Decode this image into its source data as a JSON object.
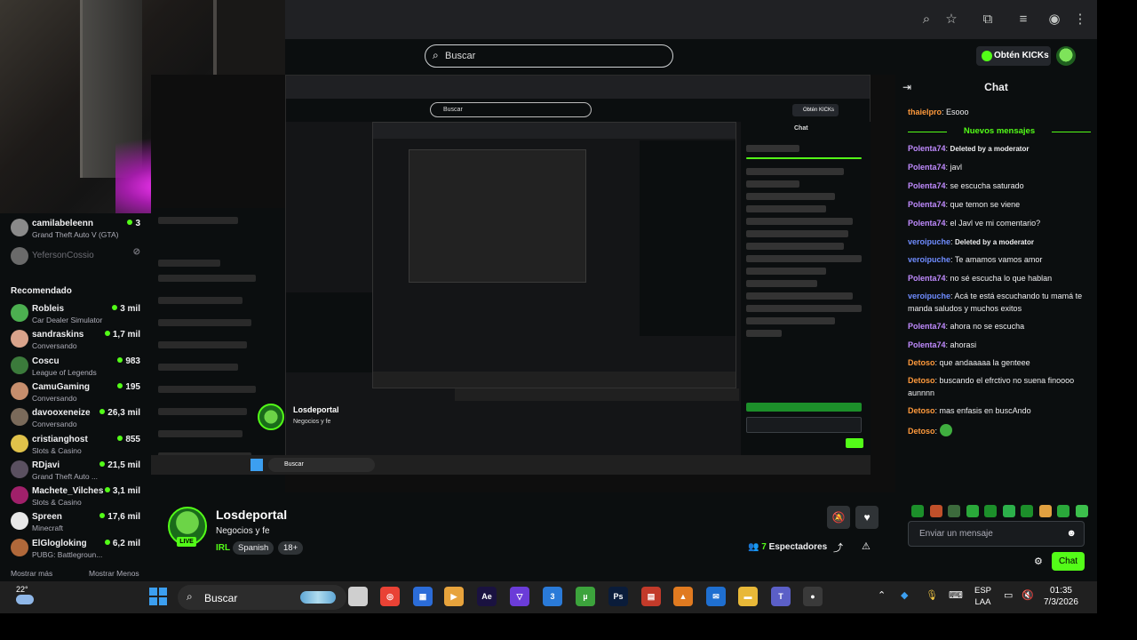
{
  "browser": {
    "icons": [
      "zoom-icon",
      "star-icon",
      "extensions-icon",
      "media-icon",
      "profile-icon",
      "menu-icon"
    ]
  },
  "header": {
    "search_placeholder": "Buscar",
    "kicks_label": "Obtén KICKs"
  },
  "sidebar": {
    "following": [
      {
        "name": "camilabeleenn",
        "category": "Grand Theft Auto V (GTA)",
        "viewers": "3"
      },
      {
        "name": "YefersonCossio",
        "category": "",
        "viewers": ""
      }
    ],
    "recommended_title": "Recomendado",
    "recommended": [
      {
        "name": "Robleis",
        "category": "Car Dealer Simulator",
        "viewers": "3 mil"
      },
      {
        "name": "sandraskins",
        "category": "Conversando",
        "viewers": "1,7 mil"
      },
      {
        "name": "Coscu",
        "category": "League of Legends",
        "viewers": "983"
      },
      {
        "name": "CamuGaming",
        "category": "Conversando",
        "viewers": "195"
      },
      {
        "name": "davooxeneize",
        "category": "Conversando",
        "viewers": "26,3 mil"
      },
      {
        "name": "cristianghost",
        "category": "Slots & Casino",
        "viewers": "855"
      },
      {
        "name": "RDjavi",
        "category": "Grand Theft Auto ...",
        "viewers": "21,5 mil"
      },
      {
        "name": "Machete_Vilches",
        "category": "Slots & Casino",
        "viewers": "3,1 mil"
      },
      {
        "name": "Spreen",
        "category": "Minecraft",
        "viewers": "17,6 mil"
      },
      {
        "name": "ElGlogloking",
        "category": "PUBG: Battlegroun...",
        "viewers": "6,2 mil"
      }
    ],
    "show_more": "Mostrar más",
    "show_less": "Mostrar Menos"
  },
  "nested": {
    "search": "Buscar",
    "chat_title": "Chat",
    "kicks": "Obtén KICKs"
  },
  "stream": {
    "channel": "Losdeportal",
    "title": "Negocios y fe",
    "category": "IRL",
    "tags": [
      "Spanish",
      "18+"
    ],
    "live": "LIVE",
    "viewers_count": "7",
    "viewers_label": "Espectadores"
  },
  "chat": {
    "title": "Chat",
    "new_messages": "Nuevos mensajes",
    "messages": [
      {
        "user": "thaielpro",
        "color": "#ff9a3c",
        "text": "Esooo"
      },
      {
        "user": "Polenta74",
        "color": "#c08bff",
        "text": "Deleted by a moderator",
        "deleted": true
      },
      {
        "user": "Polenta74",
        "color": "#c08bff",
        "text": "javl"
      },
      {
        "user": "Polenta74",
        "color": "#c08bff",
        "text": "se escucha saturado"
      },
      {
        "user": "Polenta74",
        "color": "#c08bff",
        "text": "que temon se viene"
      },
      {
        "user": "Polenta74",
        "color": "#c08bff",
        "text": "el Javl ve mi comentario?"
      },
      {
        "user": "veroipuche",
        "color": "#6f8cff",
        "text": "Deleted by a moderator",
        "deleted": true
      },
      {
        "user": "veroipuche",
        "color": "#6f8cff",
        "text": "Te amamos vamos amor"
      },
      {
        "user": "Polenta74",
        "color": "#c08bff",
        "text": "no sé escucha lo que hablan"
      },
      {
        "user": "veroipuche",
        "color": "#6f8cff",
        "text": "Acá te está escuchando tu mamá te manda saludos y muchos exitos"
      },
      {
        "user": "Polenta74",
        "color": "#c08bff",
        "text": "ahora no se escucha"
      },
      {
        "user": "Polenta74",
        "color": "#c08bff",
        "text": "ahorasi"
      },
      {
        "user": "Detoso",
        "color": "#ff9a3c",
        "text": "que andaaaaa la genteee"
      },
      {
        "user": "Detoso",
        "color": "#ff9a3c",
        "text": "buscando el efrctivo no suena finoooo aunnnn"
      },
      {
        "user": "Detoso",
        "color": "#ff9a3c",
        "text": "mas enfasis en buscAndo"
      },
      {
        "user": "Detoso",
        "color": "#ff9a3c",
        "text": ""
      }
    ],
    "input_placeholder": "Enviar un mensaje",
    "send_label": "Chat"
  },
  "taskbar": {
    "temperature": "22°",
    "search": "Buscar",
    "apps": [
      "file-explorer-icon",
      "chrome-icon",
      "store-icon",
      "media-player-icon",
      "after-effects-icon",
      "brave-icon",
      "app-3-icon",
      "utorrent-icon",
      "photoshop-icon",
      "calendar-icon",
      "vlc-icon",
      "outlook-icon",
      "folder-icon",
      "teams-icon",
      "obs-icon"
    ],
    "lang_top": "ESP",
    "lang_bottom": "LAA",
    "time": "01:35",
    "date": "7/3/2026"
  }
}
